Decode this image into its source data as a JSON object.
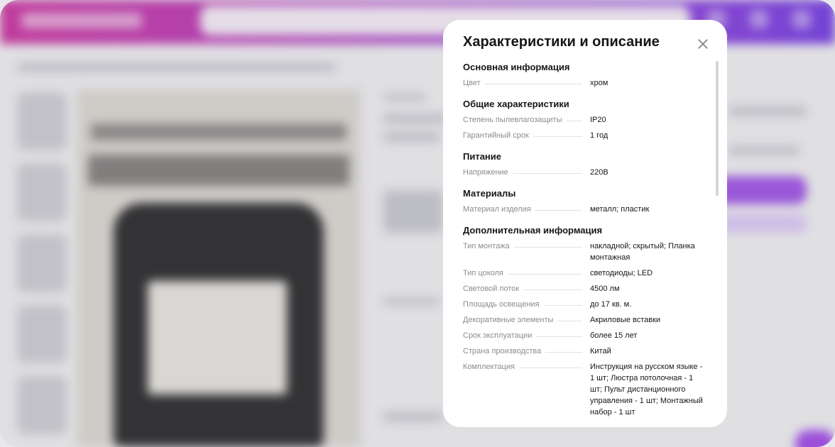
{
  "modal": {
    "title": "Характеристики и описание",
    "sections": [
      {
        "title": "Основная информация",
        "rows": [
          {
            "key": "Цвет",
            "value": "хром"
          }
        ]
      },
      {
        "title": "Общие характеристики",
        "rows": [
          {
            "key": "Степень пылевлагозащиты",
            "value": "IP20"
          },
          {
            "key": "Гарантийный срок",
            "value": "1 год"
          }
        ]
      },
      {
        "title": "Питание",
        "rows": [
          {
            "key": "Напряжение",
            "value": "220В"
          }
        ]
      },
      {
        "title": "Материалы",
        "rows": [
          {
            "key": "Материал изделия",
            "value": "металл; пластик"
          }
        ]
      },
      {
        "title": "Дополнительная информация",
        "rows": [
          {
            "key": "Тип монтажа",
            "value": "накладной; скрытый; Планка монтажная"
          },
          {
            "key": "Тип цоколя",
            "value": "светодиоды; LED"
          },
          {
            "key": "Световой поток",
            "value": "4500 лм"
          },
          {
            "key": "Площадь освещения",
            "value": "до 17 кв. м."
          },
          {
            "key": "Декоративные элементы",
            "value": "Акриловые вставки"
          },
          {
            "key": "Срок эксплуатации",
            "value": "более 15 лет"
          },
          {
            "key": "Страна производства",
            "value": "Китай"
          },
          {
            "key": "Комплектация",
            "value": "Инструкция на русском языке - 1 шт; Люстра потолочная - 1 шт; Пульт дистанционного управления - 1 шт; Монтажный набор - 1 шт"
          }
        ]
      }
    ]
  },
  "icons": {
    "close": "close-icon"
  },
  "colors": {
    "header_gradient_start": "#c8269a",
    "header_gradient_end": "#6b2fe0",
    "accent": "#8a2be2"
  }
}
